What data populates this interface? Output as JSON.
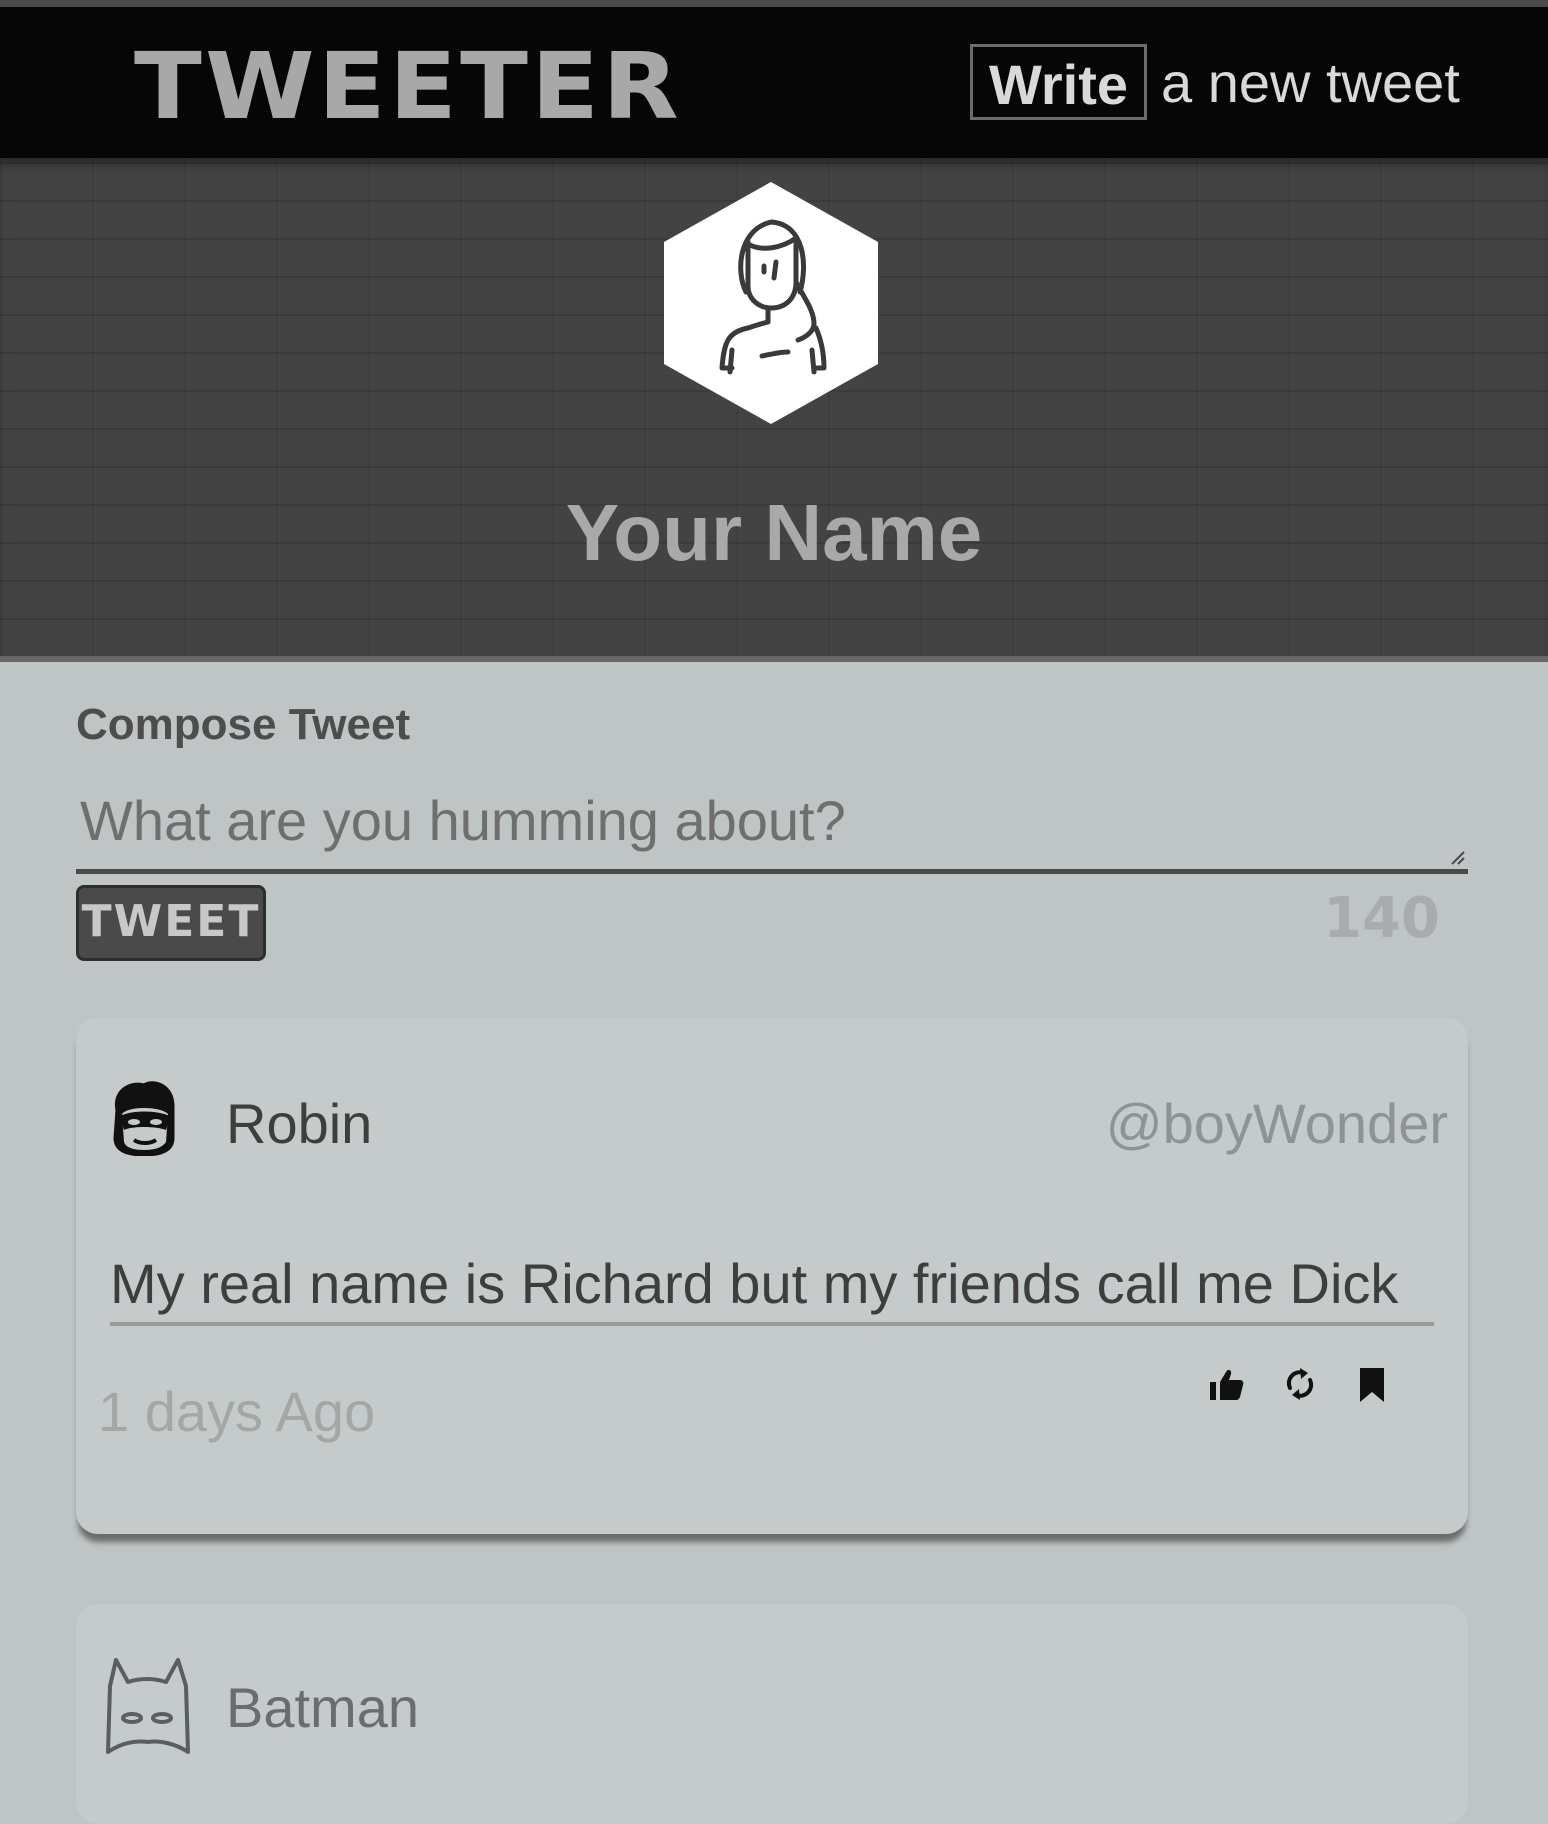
{
  "navbar": {
    "brand": "TWEETER",
    "write_label": "Write",
    "write_rest": "a new tweet"
  },
  "profile": {
    "avatar_icon": "woman-avatar-icon",
    "name": "Your Name"
  },
  "compose": {
    "title": "Compose Tweet",
    "placeholder": "What are you humming about?",
    "button_label": "TWEET",
    "char_count": "140"
  },
  "tweets": [
    {
      "avatar_icon": "robin-mask-icon",
      "author": "Robin",
      "handle": "@boyWonder",
      "text": "My real name is Richard but my friends call me Dick",
      "time": "1 days Ago",
      "actions": [
        "thumbs-up-icon",
        "retweet-icon",
        "bookmark-icon"
      ]
    },
    {
      "avatar_icon": "batman-mask-icon",
      "author": "Batman"
    }
  ],
  "colors": {
    "navbar_bg": "#070607",
    "hero_bg": "#434343",
    "page_bg": "#bec5c4",
    "card_bg": "#c5cbca"
  }
}
